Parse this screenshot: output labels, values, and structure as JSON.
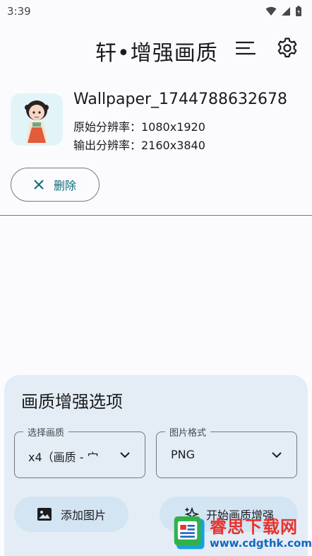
{
  "status_bar": {
    "time": "3:39"
  },
  "app_bar": {
    "title": "轩•增强画质",
    "menu_icon": "sort-lines-icon",
    "settings_icon": "gear-icon"
  },
  "image": {
    "file_name": "Wallpaper_1744788632678",
    "original_resolution": "原始分辨率：1080x1920",
    "output_resolution": "输出分辨率：2160x3840"
  },
  "delete_button": {
    "label": "删除",
    "icon": "close-icon"
  },
  "options": {
    "title": "画质增强选项",
    "quality": {
      "label": "选择画质",
      "value": "x4（画质 - 宀"
    },
    "format": {
      "label": "图片格式",
      "value": "PNG"
    },
    "add_image_label": "添加图片",
    "start_label": "开始画质增强"
  },
  "watermark": {
    "brand": "睿思下载网",
    "url": "www.cdgthk.com"
  }
}
